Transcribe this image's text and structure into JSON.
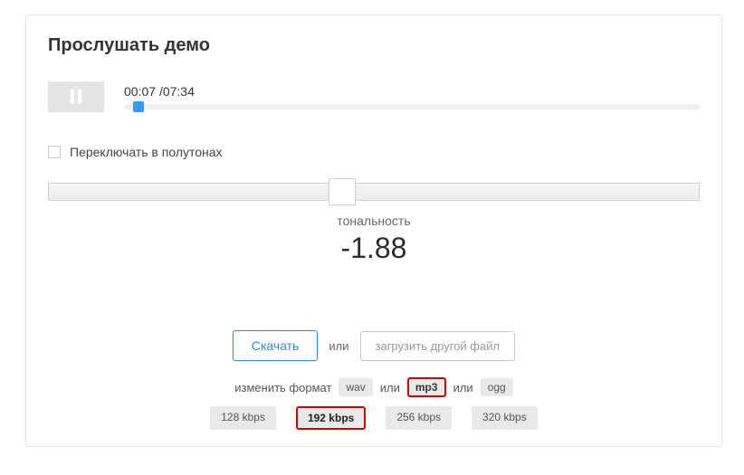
{
  "title": "Прослушать демо",
  "player": {
    "current_time": "00:07",
    "total_time": "07:34",
    "progress_percent": 1.5
  },
  "semitone_checkbox": {
    "checked": false,
    "label": "Переключать в полутонах"
  },
  "tone": {
    "label": "тональность",
    "value": "-1.88",
    "slider_percent": 43
  },
  "actions": {
    "download_label": "Скачать",
    "or_text": "или",
    "upload_label": "загрузить другой файл"
  },
  "format": {
    "change_label": "изменить формат",
    "or_text": "или",
    "options": [
      "wav",
      "mp3",
      "ogg"
    ],
    "selected": "mp3"
  },
  "bitrate": {
    "options": [
      "128 kbps",
      "192 kbps",
      "256 kbps",
      "320 kbps"
    ],
    "selected": "192 kbps"
  }
}
